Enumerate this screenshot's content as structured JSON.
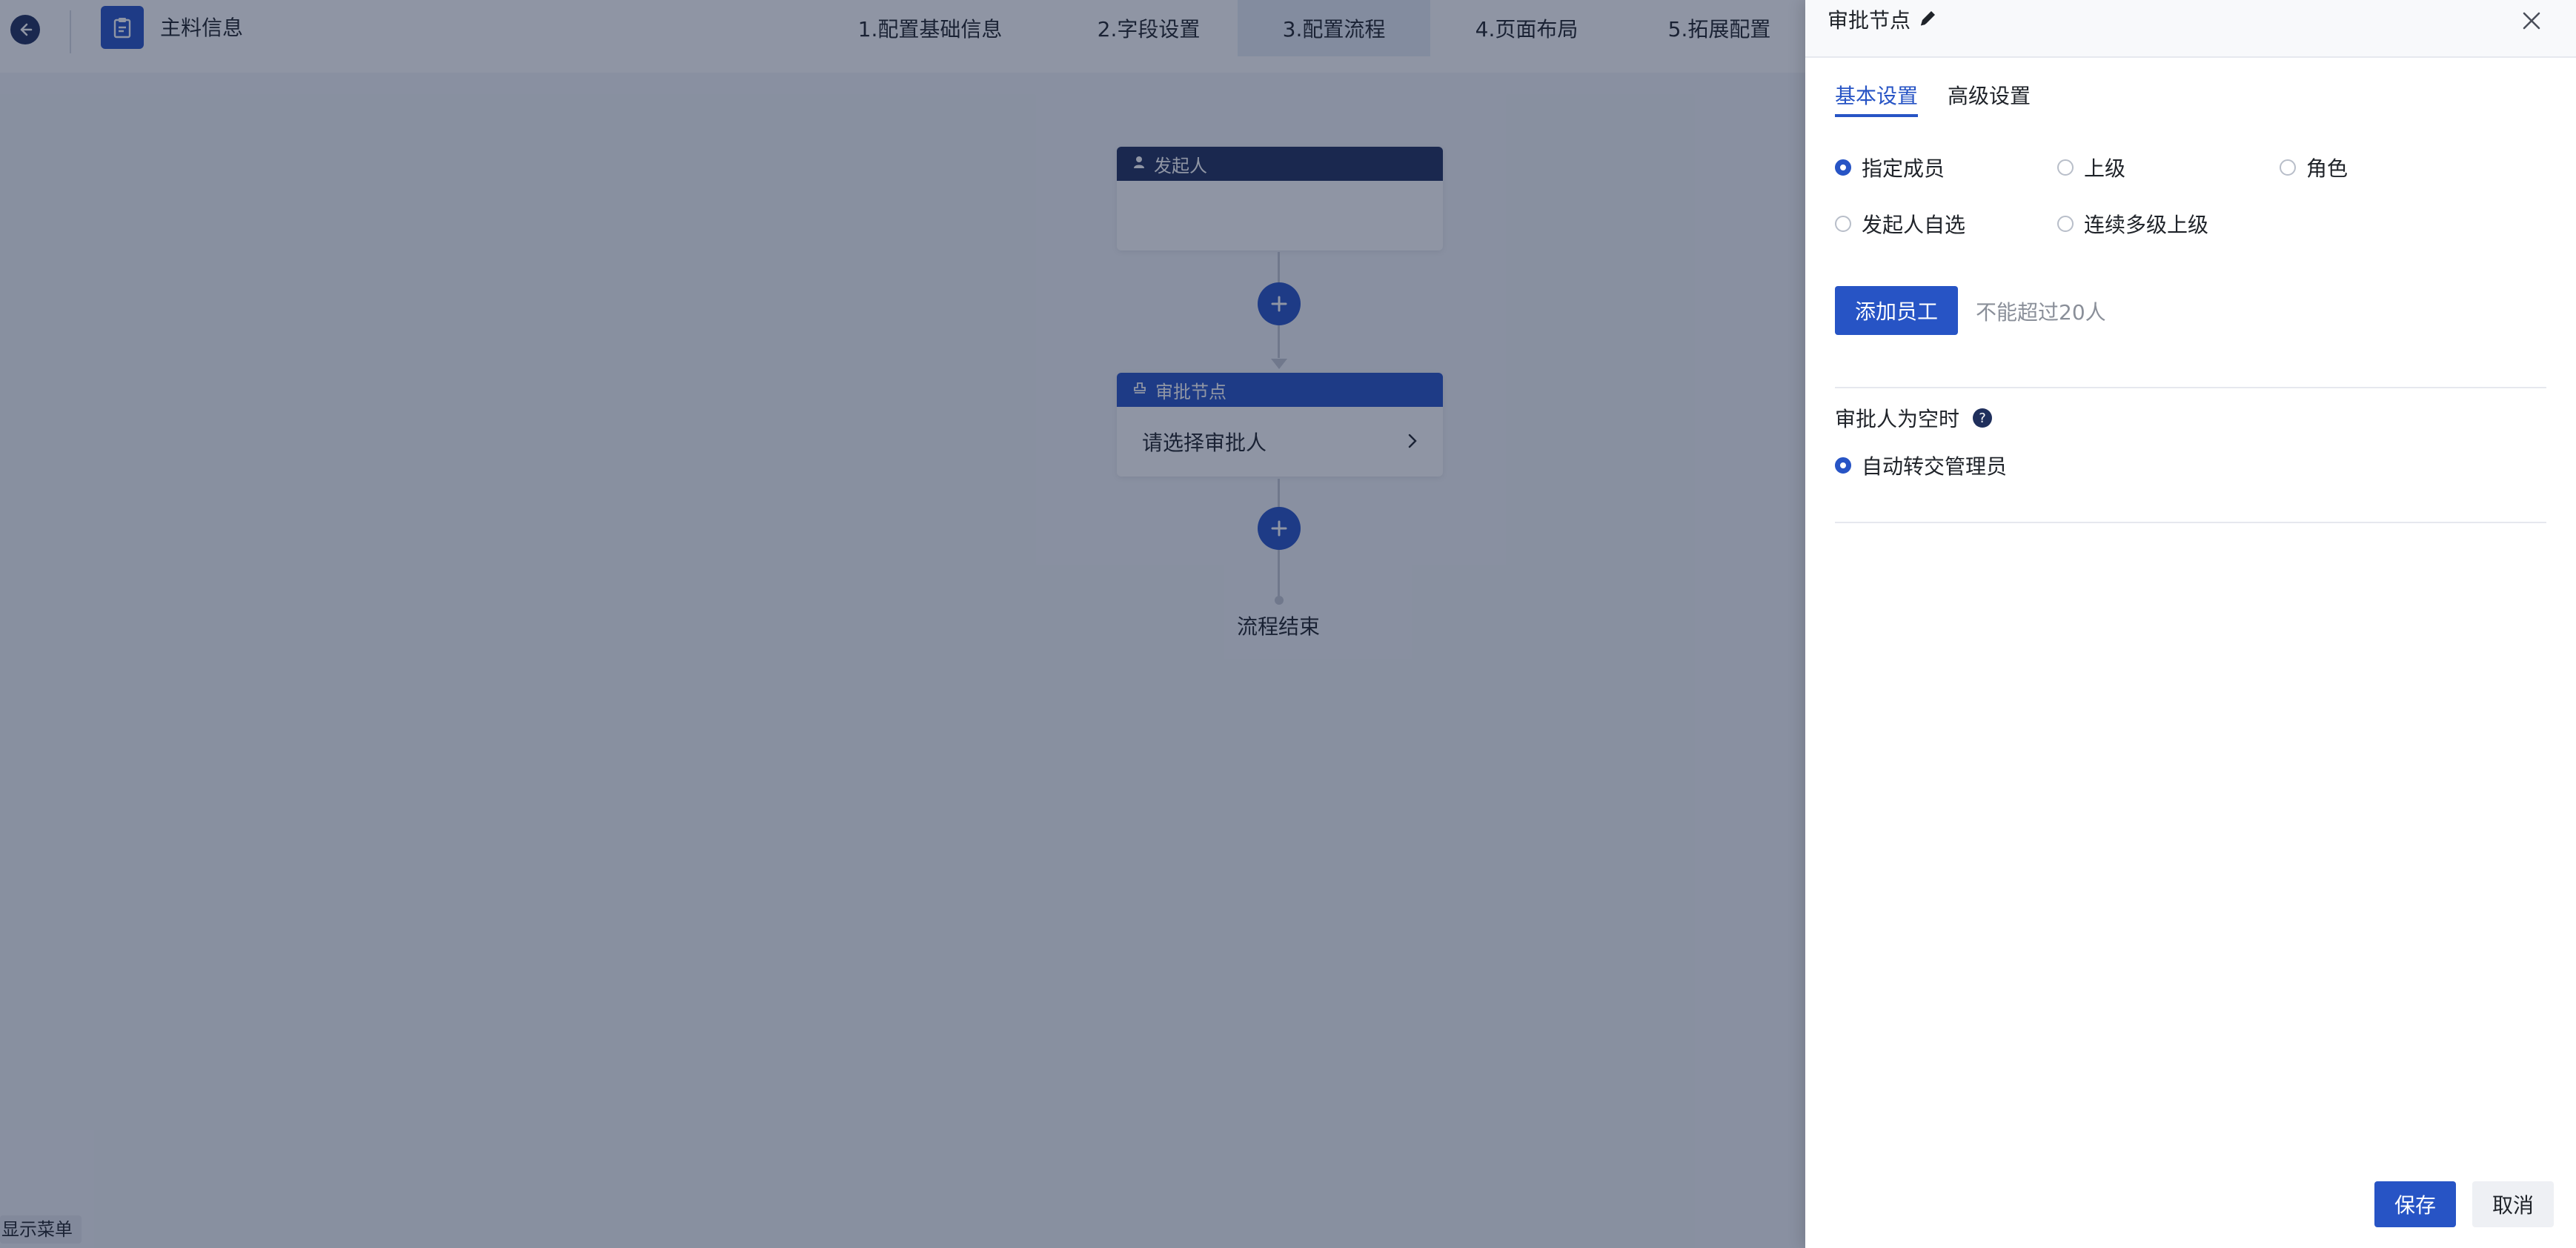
{
  "header": {
    "app_title": "主料信息",
    "steps": [
      "1.配置基础信息",
      "2.字段设置",
      "3.配置流程",
      "4.页面布局",
      "5.拓展配置"
    ]
  },
  "flow": {
    "initiator_node": {
      "title": "发起人"
    },
    "approval_node": {
      "title": "审批节点",
      "body": "请选择审批人"
    },
    "end_label": "流程结束"
  },
  "footer": {
    "show_menu": "显示菜单"
  },
  "drawer": {
    "title": "审批节点",
    "tabs": [
      "基本设置",
      "高级设置"
    ],
    "approver_options": {
      "row1": [
        "指定成员",
        "上级",
        "角色"
      ],
      "row2": [
        "发起人自选",
        "连续多级上级"
      ]
    },
    "selected_option": "指定成员",
    "add_staff_label": "添加员工",
    "limit_hint": "不能超过20人",
    "empty_approver_label": "审批人为空时",
    "empty_approver_option": "自动转交管理员",
    "save_label": "保存",
    "cancel_label": "取消"
  },
  "colors": {
    "accent": "#2754c5",
    "header_dark": "#1f2f5c"
  },
  "icons": [
    "back-arrow-icon",
    "clipboard-icon",
    "user-icon",
    "stamp-icon",
    "plus-icon",
    "chevron-right-icon",
    "pencil-icon",
    "close-icon",
    "help-icon"
  ]
}
